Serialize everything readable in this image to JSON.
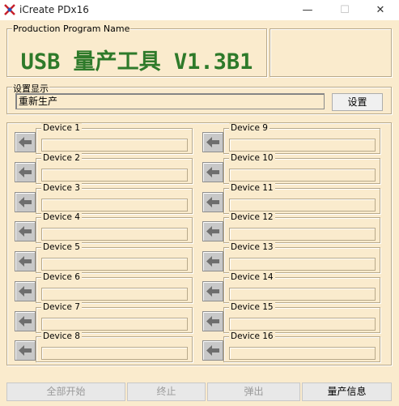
{
  "window": {
    "title": "iCreate PDx16",
    "min_glyph": "—",
    "max_glyph": "☐",
    "close_glyph": "✕"
  },
  "header": {
    "group_label": "Production Program Name",
    "program_title": "USB 量产工具 V1.3B1"
  },
  "settings": {
    "group_label": "设置显示",
    "value": "重新生产",
    "button_label": "设置"
  },
  "devices_left": [
    {
      "label": "Device 1"
    },
    {
      "label": "Device 2"
    },
    {
      "label": "Device 3"
    },
    {
      "label": "Device 4"
    },
    {
      "label": "Device 5"
    },
    {
      "label": "Device 6"
    },
    {
      "label": "Device 7"
    },
    {
      "label": "Device 8"
    }
  ],
  "devices_right": [
    {
      "label": "Device 9"
    },
    {
      "label": "Device 10"
    },
    {
      "label": "Device 11"
    },
    {
      "label": "Device 12"
    },
    {
      "label": "Device 13"
    },
    {
      "label": "Device 14"
    },
    {
      "label": "Device 15"
    },
    {
      "label": "Device 16"
    }
  ],
  "device_icon": "arrow-left-icon",
  "bottom_buttons": {
    "start_all": "全部开始",
    "stop": "终止",
    "eject": "弹出",
    "production_info": "量产信息"
  },
  "colors": {
    "background": "#faebcd",
    "title_green": "#2e7a2a"
  }
}
